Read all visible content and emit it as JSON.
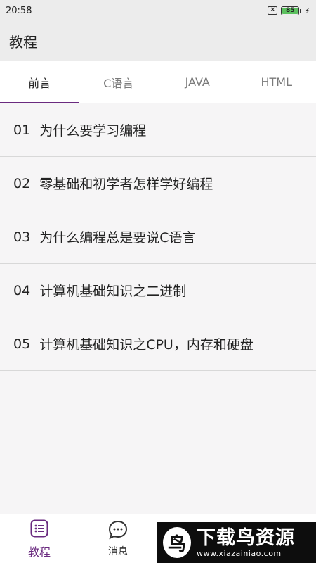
{
  "status_bar": {
    "time": "20:58",
    "battery_level": "85"
  },
  "app_bar": {
    "title": "教程"
  },
  "tabs": [
    {
      "label": "前言",
      "active": true
    },
    {
      "label": "C语言",
      "active": false
    },
    {
      "label": "JAVA",
      "active": false
    },
    {
      "label": "HTML",
      "active": false
    }
  ],
  "list": [
    {
      "num": "01",
      "title": "为什么要学习编程"
    },
    {
      "num": "02",
      "title": "零基础和初学者怎样学好编程"
    },
    {
      "num": "03",
      "title": "为什么编程总是要说C语言"
    },
    {
      "num": "04",
      "title": "计算机基础知识之二进制"
    },
    {
      "num": "05",
      "title": "计算机基础知识之CPU，内存和硬盘"
    }
  ],
  "bottom_nav": [
    {
      "label": "教程",
      "icon": "list-icon",
      "active": true
    },
    {
      "label": "消息",
      "icon": "chat-bubble-icon",
      "active": false
    }
  ],
  "watermark": {
    "title": "下载鸟资源",
    "url": "www.xiazainiao.com"
  },
  "colors": {
    "accent": "#6a2a7f",
    "battery": "#5cc15f"
  }
}
